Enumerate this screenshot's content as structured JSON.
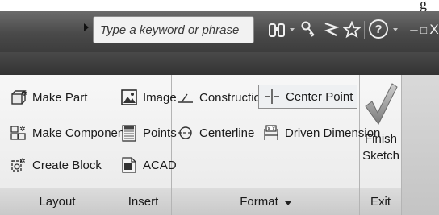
{
  "top": {
    "partial_text": "g"
  },
  "search": {
    "placeholder": "Type a keyword or phrase"
  },
  "titlebar_icons": {
    "binoculars": "binoculars-icon",
    "key": "key-icon",
    "satellite": "satellite-icon",
    "star": "star-icon",
    "help": "?",
    "minimize": "–",
    "maximize": "□",
    "close": "X"
  },
  "panels": {
    "layout": {
      "label": "Layout",
      "items": [
        {
          "label": "Make Part",
          "icon": "make-part-icon"
        },
        {
          "label": "Make Components",
          "icon": "make-components-icon"
        },
        {
          "label": "Create Block",
          "icon": "create-block-icon"
        }
      ]
    },
    "insert": {
      "label": "Insert",
      "items": [
        {
          "label": "Image",
          "icon": "image-icon"
        },
        {
          "label": "Points",
          "icon": "points-icon"
        },
        {
          "label": "ACAD",
          "icon": "acad-icon"
        }
      ]
    },
    "format": {
      "label": "Format",
      "items": [
        {
          "label": "Construction",
          "icon": "construction-icon"
        },
        {
          "label": "Center Point",
          "icon": "center-point-icon"
        },
        {
          "label": "Centerline",
          "icon": "centerline-icon"
        },
        {
          "label": "Driven Dimension",
          "icon": "driven-dimension-icon"
        }
      ]
    },
    "exit": {
      "label": "Exit",
      "finish_line1": "Finish",
      "finish_line2": "Sketch"
    }
  }
}
